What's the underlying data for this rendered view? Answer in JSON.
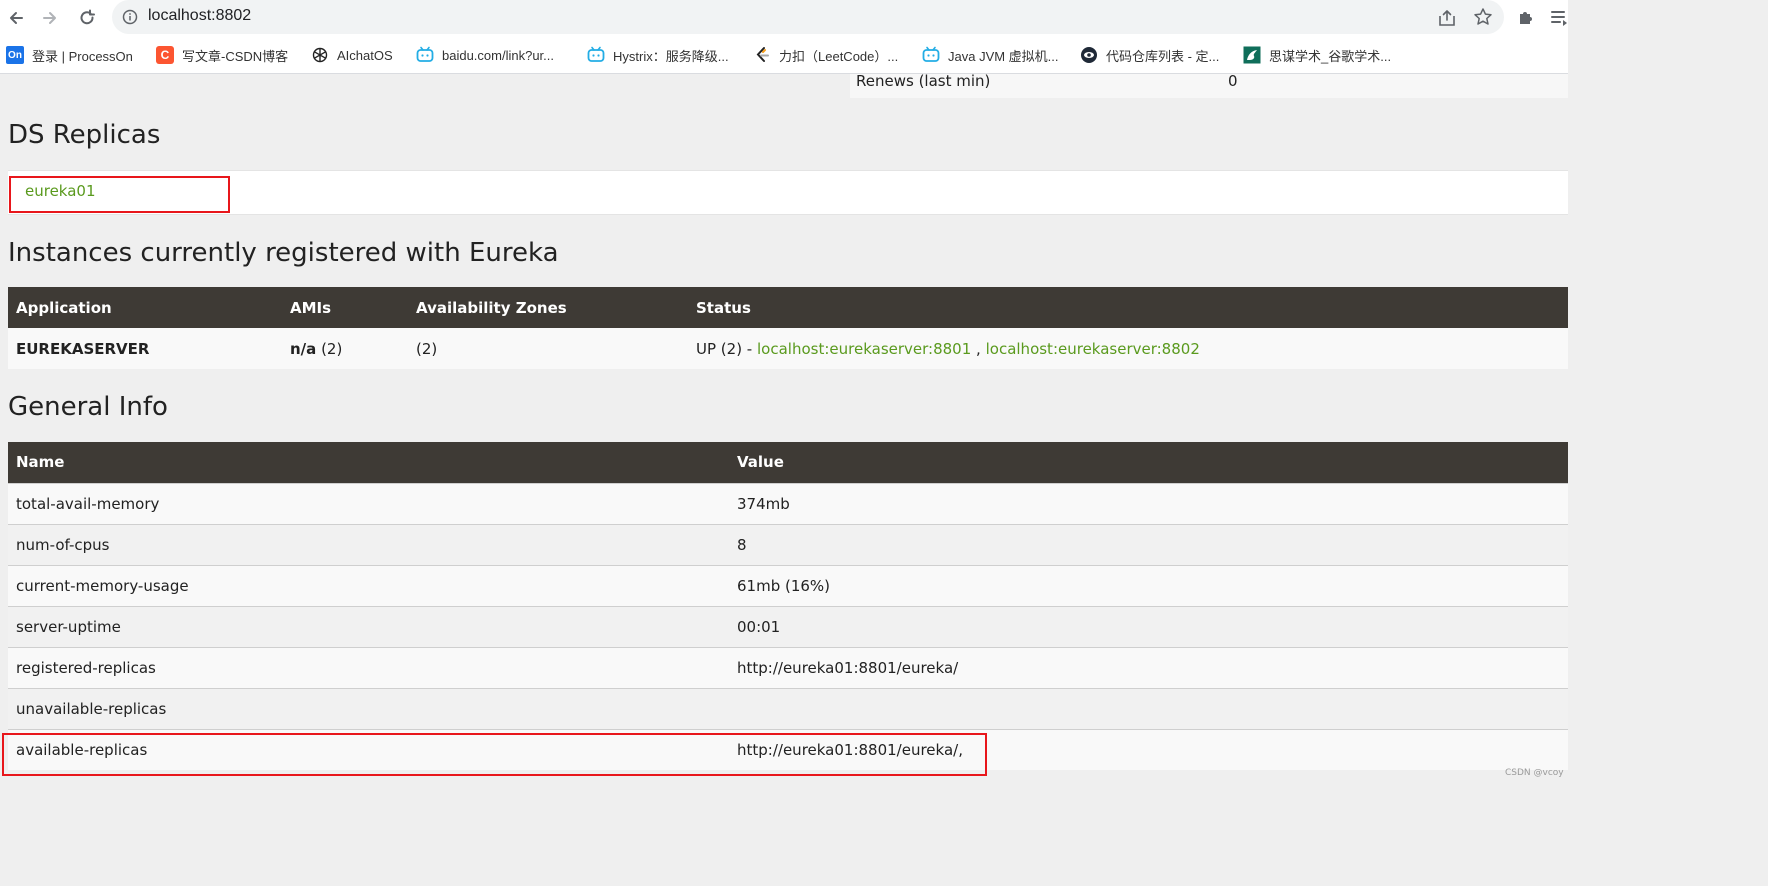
{
  "browser": {
    "url": "localhost:8802",
    "bookmarks": [
      {
        "label": "登录 | ProcessOn",
        "icon": "processon-icon",
        "badge": "On",
        "color": "#1a73e8"
      },
      {
        "label": "写文章-CSDN博客",
        "icon": "csdn-icon",
        "badge": "C",
        "color": "#fc5531"
      },
      {
        "label": "AIchatOS",
        "icon": "openai-icon"
      },
      {
        "label": "baidu.com/link?ur...",
        "icon": "bilibili-icon",
        "color": "#23ade5"
      },
      {
        "label": "Hystrix：服务降级...",
        "icon": "bilibili-icon",
        "color": "#23ade5"
      },
      {
        "label": "力扣（LeetCode）...",
        "icon": "leetcode-icon"
      },
      {
        "label": "Java JVM 虚拟机...",
        "icon": "bilibili-icon",
        "color": "#23ade5"
      },
      {
        "label": "代码仓库列表 - 定...",
        "icon": "repo-icon"
      },
      {
        "label": "思谋学术_谷歌学术...",
        "icon": "simou-icon",
        "color": "#0f6e5a"
      }
    ]
  },
  "page": {
    "renews": {
      "label": "Renews (last min)",
      "value": "0"
    },
    "ds_replicas": {
      "title": "DS Replicas",
      "items": [
        "eureka01"
      ]
    },
    "instances": {
      "title": "Instances currently registered with Eureka",
      "headers": [
        "Application",
        "AMIs",
        "Availability Zones",
        "Status"
      ],
      "rows": [
        {
          "application": "EUREKASERVER",
          "amis_na": "n/a",
          "amis_count": "(2)",
          "zones": "(2)",
          "status_prefix": "UP (2) -",
          "links": [
            "localhost:eurekaserver:8801",
            "localhost:eurekaserver:8802"
          ],
          "separator": ","
        }
      ]
    },
    "general_info": {
      "title": "General Info",
      "headers": [
        "Name",
        "Value"
      ],
      "rows": [
        {
          "name": "total-avail-memory",
          "value": "374mb"
        },
        {
          "name": "num-of-cpus",
          "value": "8"
        },
        {
          "name": "current-memory-usage",
          "value": "61mb (16%)"
        },
        {
          "name": "server-uptime",
          "value": "00:01"
        },
        {
          "name": "registered-replicas",
          "value": "http://eureka01:8801/eureka/"
        },
        {
          "name": "unavailable-replicas",
          "value": ""
        },
        {
          "name": "available-replicas",
          "value": "http://eureka01:8801/eureka/,"
        }
      ]
    }
  },
  "watermark": "CSDN @vcoy",
  "colors": {
    "accent_link": "#5a9a1e",
    "header_bg": "#3e3a35",
    "highlight": "#e8161b"
  }
}
